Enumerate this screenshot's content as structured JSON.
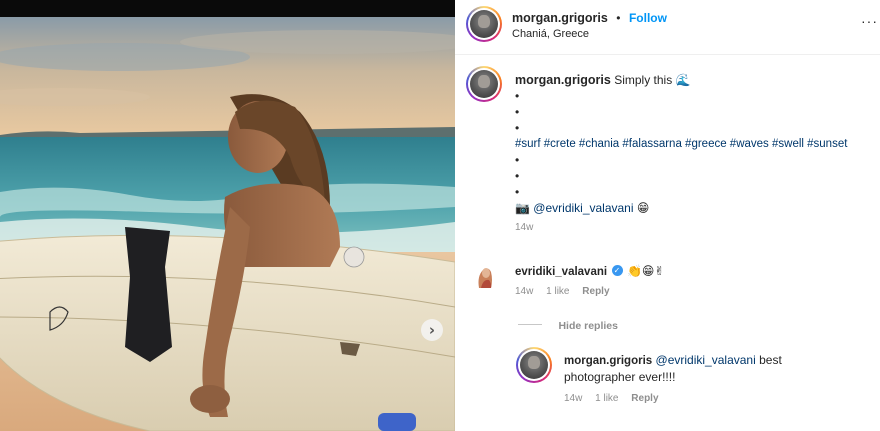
{
  "post": {
    "author": "morgan.grigoris",
    "separator": "•",
    "follow_label": "Follow",
    "location": "Chaniá, Greece",
    "more_icon": "ellipsis-icon"
  },
  "caption": {
    "author": "morgan.grigoris",
    "text": "Simply this",
    "wave_emoji": "🌊",
    "bullets": [
      "•",
      "•",
      "•"
    ],
    "hashtags": "#surf #crete #chania #falassarna #greece #waves #swell #sunset",
    "bullets2": [
      "•",
      "•",
      "•"
    ],
    "camera_emoji": "📷",
    "photo_credit": "@evridiki_valavani",
    "credit_emoji": "😁",
    "time": "14w"
  },
  "comment": {
    "author": "evridiki_valavani",
    "emojis": "👏😁✌",
    "time": "14w",
    "likes": "1 like",
    "reply_label": "Reply",
    "hide_replies": "Hide replies"
  },
  "reply": {
    "author": "morgan.grigoris",
    "mention": "@evridiki_valavani",
    "text_line1": "best",
    "text_line2": "photographer ever!!!!",
    "time": "14w",
    "likes": "1 like",
    "reply_label": "Reply"
  },
  "carousel": {
    "next_glyph": "›"
  }
}
